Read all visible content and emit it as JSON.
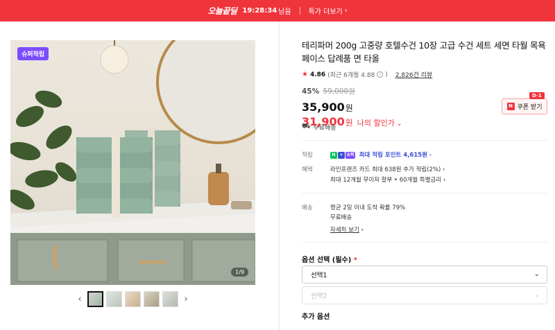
{
  "deal_banner": {
    "label": "오늘끝딜",
    "timer": "19:28:34",
    "timer_suffix": "남음",
    "more_label": "특가 더보기"
  },
  "gallery": {
    "badge": "슈퍼적립",
    "counter": "1/9",
    "thumbnail_count": 5,
    "active_thumbnail": 1
  },
  "product": {
    "title": "테리파머 200g 고중량 호텔수건 10장 고급 수건 세트 세면 타월 목욕 페이스 답례품 면 타올",
    "rating": "4.86",
    "rating_recent": "(최근 6개월 4.88",
    "review_count": "2,826건 리뷰",
    "discount_pct": "45%",
    "original_price": "59,000원",
    "price": "35,900",
    "price_unit": "원",
    "my_price": "31,900",
    "my_price_unit": "원",
    "my_price_label": "나의 할인가",
    "coupon_label": "쿠폰 받기",
    "coupon_dday": "D-1",
    "shipping": "무료배송"
  },
  "benefits": {
    "points_key": "적립",
    "points_icon_n": "N",
    "points_icon_plus": "+",
    "points_icon_super": "슈퍼",
    "points_value": "최대 적립 포인트 4,615원",
    "benefit_key": "혜택",
    "benefit_line1": "라인프렌즈 카드 최대 638원 추가 적립(2%)",
    "benefit_line2": "최대 12개월 무이자 할부 • 60개월 특별금리"
  },
  "delivery": {
    "key": "배송",
    "line1": "평균 2일 이내 도착 확률 79%",
    "line2": "무료배송",
    "detail_link": "자세히 보기"
  },
  "options": {
    "label": "옵션 선택 (필수)",
    "required_mark": "*",
    "select1": "선택1",
    "select2": "선택2",
    "additional_label": "추가 옵션"
  },
  "colors": {
    "accent": "#f0343c",
    "point_blue": "#3a4ed8",
    "super_purple": "#7b4dff"
  }
}
